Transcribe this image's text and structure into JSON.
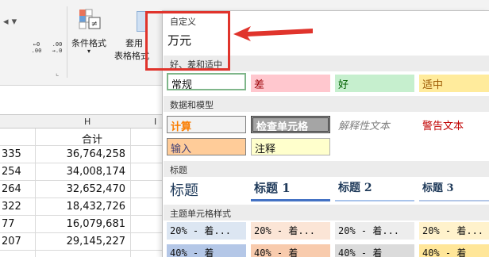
{
  "ribbon": {
    "fmt_buttons": [
      ".00\n→.0",
      ".0\n.00"
    ],
    "conditional_format": "条件格式",
    "table_format_line1": "套用",
    "table_format_line2": "表格格式"
  },
  "sheet": {
    "column_header": "H",
    "column_i": "I",
    "total_header": "合计",
    "rows": [
      {
        "a": "335",
        "b": "36,764,258"
      },
      {
        "a": "254",
        "b": "34,008,174"
      },
      {
        "a": "264",
        "b": "32,652,470"
      },
      {
        "a": "322",
        "b": "18,432,726"
      },
      {
        "a": "77",
        "b": "16,079,681"
      },
      {
        "a": "207",
        "b": "29,145,227"
      }
    ]
  },
  "styles_panel": {
    "sections": {
      "custom": "自定义",
      "good_bad": "好、差和适中",
      "data_model": "数据和模型",
      "titles": "标题",
      "theme": "主题单元格样式"
    },
    "custom_item": "万元",
    "good_bad": [
      "常规",
      "差",
      "好",
      "适中"
    ],
    "data_model_row1": [
      "计算",
      "检查单元格",
      "解释性文本",
      "警告文本"
    ],
    "data_model_row2": [
      "输入",
      "注释"
    ],
    "titles": [
      "标题",
      "标题 1",
      "标题 2",
      "标题 3"
    ],
    "theme_row1": [
      "20% - 着...",
      "20% - 着...",
      "20% - 着...",
      "20% - 着..."
    ],
    "theme_row2": [
      "40% - 着",
      "40% - 着",
      "40% - 着",
      "40% - 着"
    ]
  },
  "colors": {
    "highlight": "#e0342c",
    "bad_fill": "#ffc7ce",
    "good_fill": "#c6efce",
    "neutral_fill": "#ffeb9c"
  }
}
